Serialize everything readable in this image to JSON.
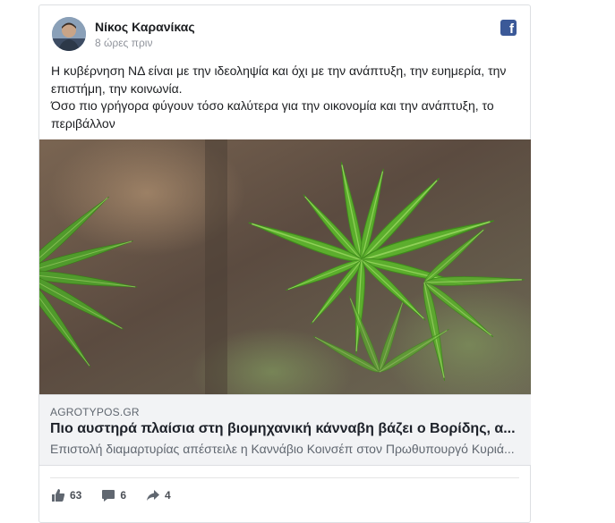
{
  "post": {
    "author": "Νίκος Καρανίκας",
    "time": "8 ώρες πριν",
    "text_line1": "Η κυβέρνηση ΝΔ είναι με την ιδεοληψία και όχι με την ανάπτυξη, την ευημερία, την επιστήμη, την κοινωνία.",
    "text_line2": "Όσο πιο γρήγορα φύγουν τόσο καλύτερα για την οικονομία και την ανάπτυξη, το περιβάλλον"
  },
  "link": {
    "domain": "AGROTYPOS.GR",
    "title": "Πιο αυστηρά πλαίσια στη βιομηχανική κάνναβη βάζει ο Βορίδης, α...",
    "description": "Επιστολή διαμαρτυρίας απέστειλε η Καννάβιο Κοινσέπ στον Πρωθυπουργό Κυριά..."
  },
  "stats": {
    "likes": "63",
    "comments": "6",
    "shares": "4"
  },
  "colors": {
    "facebook_blue": "#3b5998",
    "leaf_green": "#5cae2d"
  },
  "icons": [
    "facebook-icon",
    "like-icon",
    "comment-icon",
    "share-icon"
  ]
}
